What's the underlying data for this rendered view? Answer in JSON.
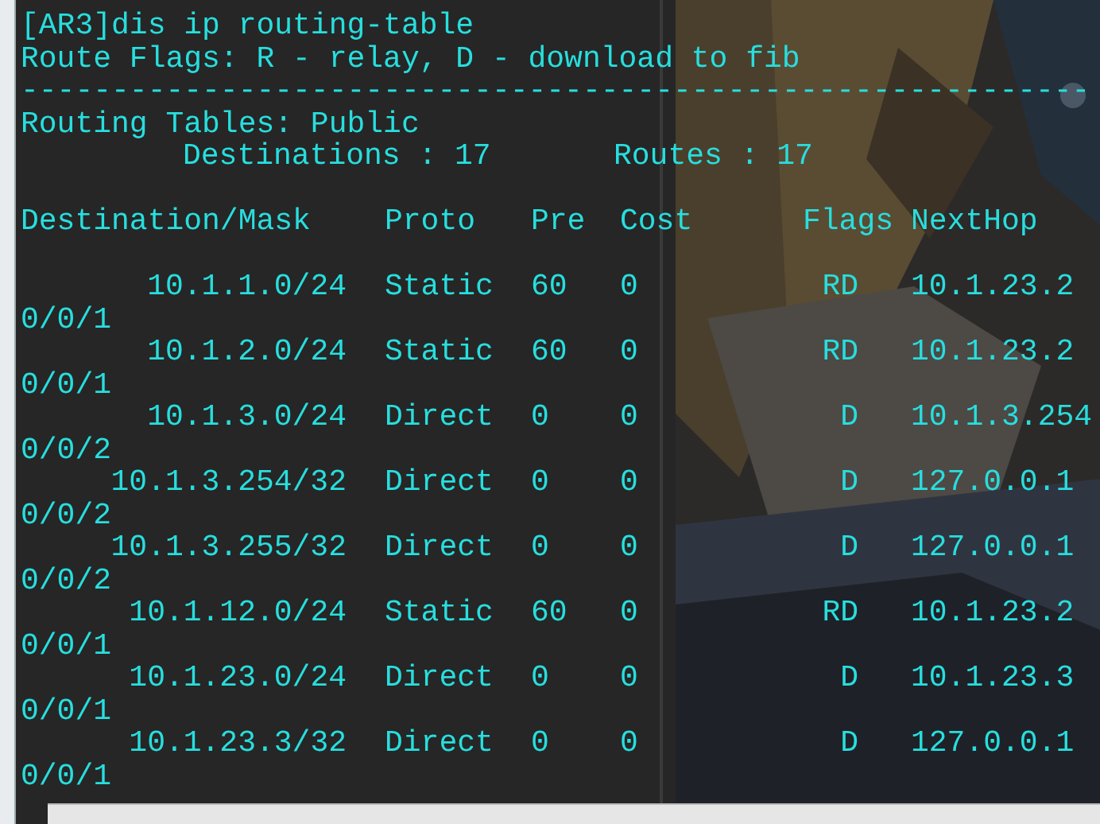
{
  "terminal": {
    "lines": [
      "[AR3]dis ip routing-table",
      "Route Flags: R - relay, D - download to fib",
      "-----------------------------------------------------------",
      "Routing Tables: Public"
    ],
    "summary": {
      "destinations": "Destinations : 17",
      "routes": "Routes : 17"
    },
    "table": {
      "columns": [
        "Destination/Mask",
        "Proto",
        "Pre",
        "Cost",
        "Flags",
        "NextHop"
      ],
      "rows": [
        {
          "destination": "10.1.1.0/24",
          "proto": "Static",
          "pre": "60",
          "cost": "0",
          "flags": "RD",
          "nexthop": "10.1.23.2",
          "interface": "0/0/1"
        },
        {
          "destination": "10.1.2.0/24",
          "proto": "Static",
          "pre": "60",
          "cost": "0",
          "flags": "RD",
          "nexthop": "10.1.23.2",
          "interface": "0/0/1"
        },
        {
          "destination": "10.1.3.0/24",
          "proto": "Direct",
          "pre": "0",
          "cost": "0",
          "flags": "D",
          "nexthop": "10.1.3.254",
          "interface": "0/0/2"
        },
        {
          "destination": "10.1.3.254/32",
          "proto": "Direct",
          "pre": "0",
          "cost": "0",
          "flags": "D",
          "nexthop": "127.0.0.1",
          "interface": "0/0/2"
        },
        {
          "destination": "10.1.3.255/32",
          "proto": "Direct",
          "pre": "0",
          "cost": "0",
          "flags": "D",
          "nexthop": "127.0.0.1",
          "interface": "0/0/2"
        },
        {
          "destination": "10.1.12.0/24",
          "proto": "Static",
          "pre": "60",
          "cost": "0",
          "flags": "RD",
          "nexthop": "10.1.23.2",
          "interface": "0/0/1"
        },
        {
          "destination": "10.1.23.0/24",
          "proto": "Direct",
          "pre": "0",
          "cost": "0",
          "flags": "D",
          "nexthop": "10.1.23.3",
          "interface": "0/0/1"
        },
        {
          "destination": "10.1.23.3/32",
          "proto": "Direct",
          "pre": "0",
          "cost": "0",
          "flags": "D",
          "nexthop": "127.0.0.1",
          "interface": "0/0/1"
        }
      ]
    }
  }
}
